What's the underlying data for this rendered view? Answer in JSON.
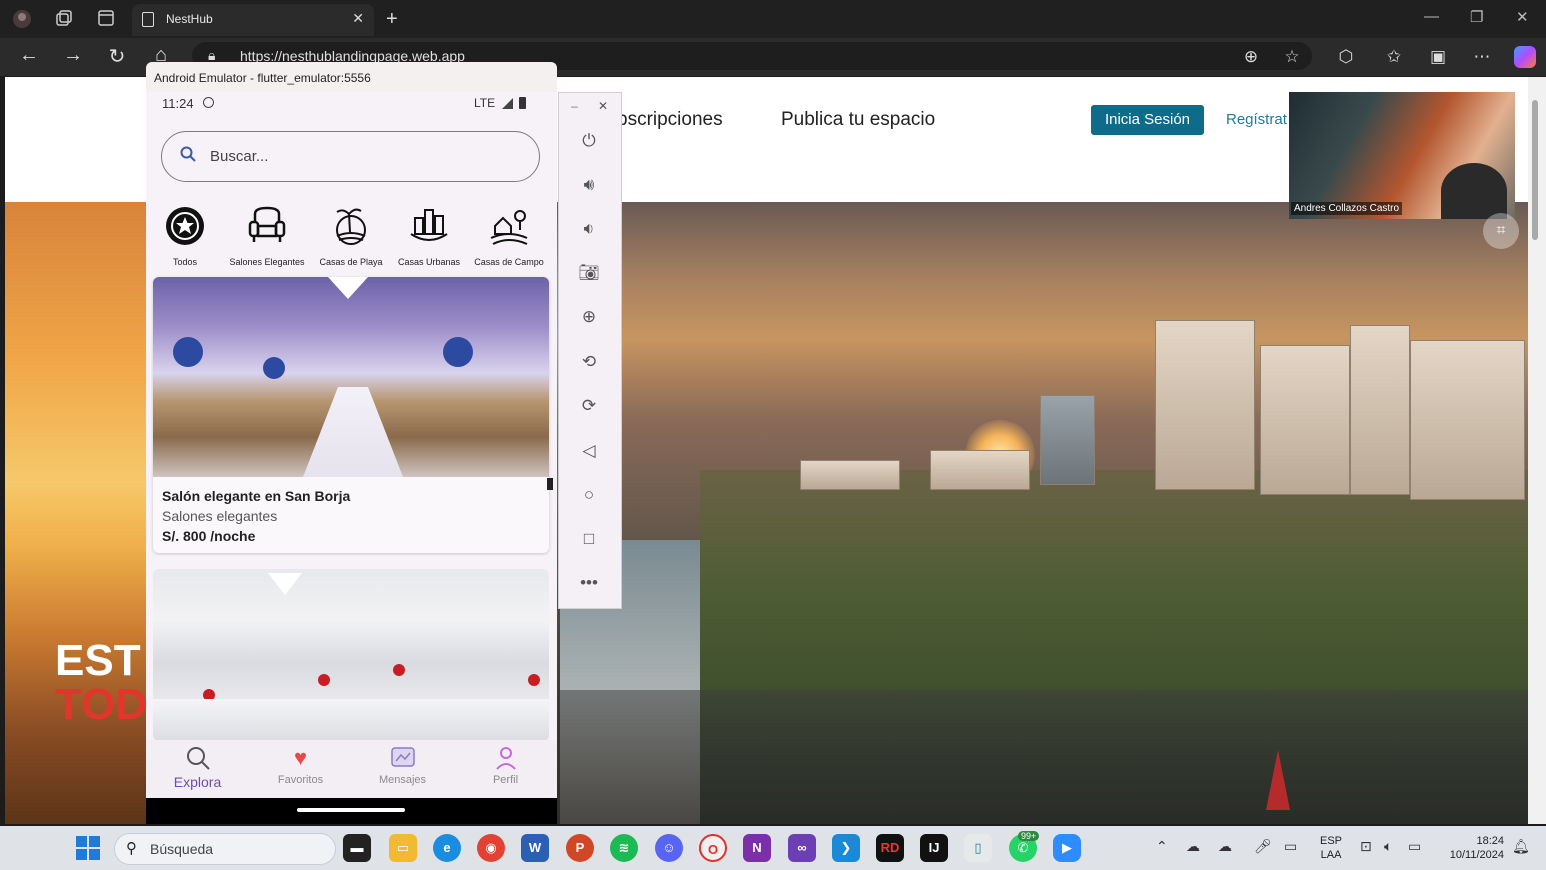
{
  "browser": {
    "tab_title": "NestHub",
    "url": "https://nesthublandingpage.web.app",
    "icons": [
      "profile-icon",
      "workspaces-icon",
      "tab-actions-icon",
      "back-icon",
      "forward-icon",
      "refresh-icon",
      "home-icon",
      "lock-icon",
      "zoom-icon",
      "favorite-icon",
      "extensions-icon",
      "favorites-icon",
      "collections-icon",
      "more-icon",
      "copilot-icon"
    ]
  },
  "landing": {
    "nav": {
      "subscripciones": "bscripciones",
      "publica": "Publica tu espacio"
    },
    "login_label": "Inicia Sesión",
    "register_label": "Regístrat",
    "hero_line1": "EST",
    "hero_line2": "TOD",
    "video_name": "Andres Collazos Castro"
  },
  "emulator": {
    "window_title": "Android Emulator - flutter_emulator:5556",
    "status_time": "11:24",
    "status_network": "LTE",
    "search_placeholder": "Buscar...",
    "categories": [
      {
        "label": "Todos",
        "icon": "star-badge-icon"
      },
      {
        "label": "Salones Elegantes",
        "icon": "armchair-icon"
      },
      {
        "label": "Casas de Playa",
        "icon": "palm-tree-icon"
      },
      {
        "label": "Casas Urbanas",
        "icon": "city-icon"
      },
      {
        "label": "Casas de Campo",
        "icon": "countryside-icon"
      }
    ],
    "listings": [
      {
        "title": "Salón elegante en San Borja",
        "category": "Salones elegantes",
        "price": "S/. 800 /noche"
      }
    ],
    "bottom_nav": [
      {
        "label": "Explora",
        "icon": "search-icon",
        "active": true
      },
      {
        "label": "Favoritos",
        "icon": "heart-icon",
        "active": false
      },
      {
        "label": "Mensajes",
        "icon": "message-icon",
        "active": false
      },
      {
        "label": "Perfil",
        "icon": "person-icon",
        "active": false
      }
    ],
    "side_toolbar": [
      "power-icon",
      "volume-up-icon",
      "volume-down-icon",
      "camera-icon",
      "zoom-in-icon",
      "rotate-left-icon",
      "rotate-right-icon",
      "back-triangle-icon",
      "home-circle-icon",
      "overview-square-icon",
      "more-dots-icon"
    ]
  },
  "taskbar": {
    "search_placeholder": "Búsqueda",
    "lang_line1": "ESP",
    "lang_line2": "LAA",
    "time": "18:24",
    "date": "10/11/2024",
    "whatsapp_badge": "99+"
  },
  "colors": {
    "login_button": "#0e6b8a",
    "register_link": "#1a7d9c",
    "hero_red": "#e0362b",
    "active_nav": "#6b4fa8",
    "heart": "#e84a4a"
  }
}
